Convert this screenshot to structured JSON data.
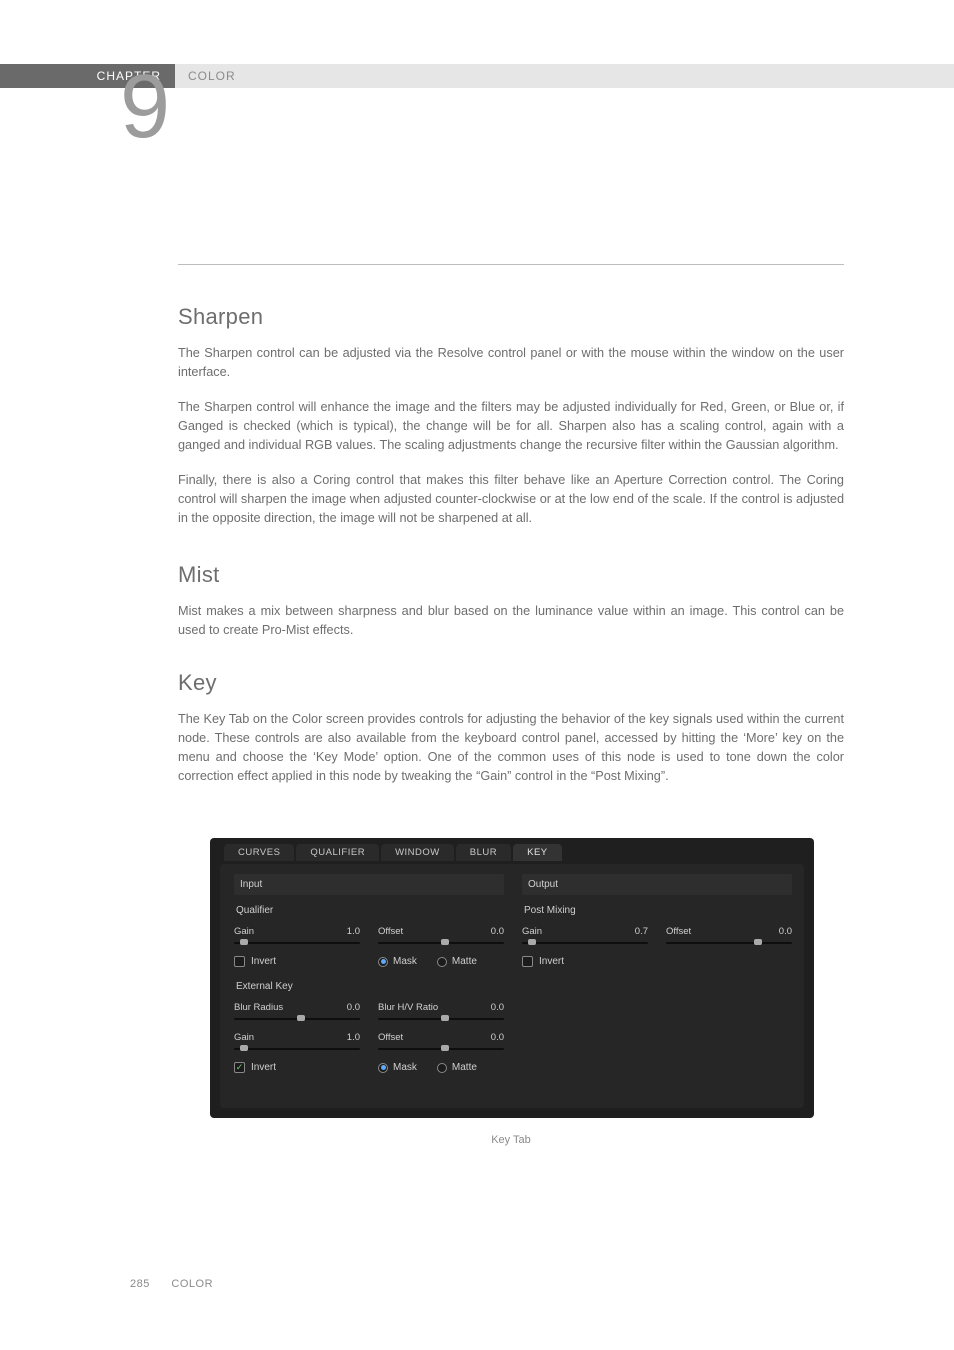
{
  "header": {
    "chapter_label": "CHAPTER",
    "title": "COLOR",
    "big_number": "9"
  },
  "sections": {
    "sharpen": {
      "heading": "Sharpen",
      "p1": "The Sharpen control can be adjusted via the Resolve control panel or with the mouse within the window on the user interface.",
      "p2": "The Sharpen control will enhance the image and the filters may be adjusted individually for Red, Green, or Blue or, if Ganged is checked (which is typical), the change will be for all. Sharpen also has a scaling control, again with a ganged and individual RGB values. The scaling adjustments change the recursive filter within the Gaussian algorithm.",
      "p3": "Finally, there is also a Coring control that makes this filter behave like an Aperture Correction control. The Coring control will sharpen the image when adjusted counter-clockwise or at the low end of the scale. If the control is adjusted in the opposite direction, the image will not be sharpened at all."
    },
    "mist": {
      "heading": "Mist",
      "p1": "Mist makes a mix between sharpness and blur based on the luminance value within an image. This control can be used to create Pro-Mist effects."
    },
    "key": {
      "heading": "Key",
      "p1": "The Key Tab on the Color screen provides controls for adjusting the behavior of the key signals used within the current node. These controls are also available from the keyboard control panel, accessed by hitting the ‘More’ key on the menu and choose the ‘Key Mode’ option. One of the common uses of this node is used to tone down the color correction effect applied in this node by tweaking the “Gain” control in the “Post Mixing”."
    }
  },
  "panel": {
    "tabs": [
      "CURVES",
      "QUALIFIER",
      "WINDOW",
      "BLUR",
      "KEY"
    ],
    "active_tab": "KEY",
    "left": {
      "input_header": "Input",
      "qualifier_label": "Qualifier",
      "gain": {
        "label": "Gain",
        "value": "1.0",
        "pos": 0.05
      },
      "offset": {
        "label": "Offset",
        "value": "0.0",
        "pos": 0.5
      },
      "invert1": {
        "label": "Invert",
        "checked": false
      },
      "mask_label": "Mask",
      "matte_label": "Matte",
      "mask_on": true,
      "external_key_label": "External Key",
      "blur_radius": {
        "label": "Blur Radius",
        "value": "0.0",
        "pos": 0.5
      },
      "blur_hv": {
        "label": "Blur H/V Ratio",
        "value": "0.0",
        "pos": 0.5
      },
      "gain2": {
        "label": "Gain",
        "value": "1.0",
        "pos": 0.05
      },
      "offset2": {
        "label": "Offset",
        "value": "0.0",
        "pos": 0.5
      },
      "invert2": {
        "label": "Invert",
        "checked": true
      }
    },
    "right": {
      "output_header": "Output",
      "post_mixing_label": "Post Mixing",
      "gain": {
        "label": "Gain",
        "value": "0.7",
        "pos": 0.05
      },
      "offset": {
        "label": "Offset",
        "value": "0.0",
        "pos": 0.7
      },
      "invert": {
        "label": "Invert",
        "checked": false
      }
    },
    "caption": "Key Tab"
  },
  "footer": {
    "page": "285",
    "title": "COLOR"
  }
}
